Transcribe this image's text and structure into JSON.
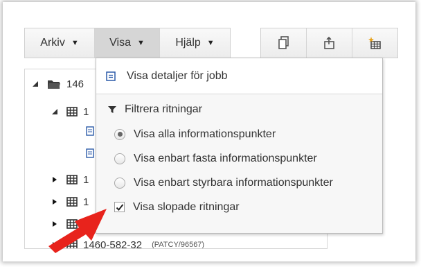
{
  "menubar": {
    "items": [
      {
        "label": "Arkiv",
        "caret": "▼"
      },
      {
        "label": "Visa",
        "caret": "▼"
      },
      {
        "label": "Hjälp",
        "caret": "▼"
      }
    ]
  },
  "toolbar_icons": [
    "copy-icon",
    "export-icon",
    "new-table-icon"
  ],
  "tree": {
    "rows": [
      {
        "text": "146",
        "icon": "folder-icon",
        "expander": "expanded"
      },
      {
        "text": "1",
        "icon": "table-icon",
        "expander": "expanded"
      },
      {
        "text": "",
        "icon": "document-icon",
        "expander": "none"
      },
      {
        "text": "",
        "icon": "document-icon",
        "expander": "none"
      },
      {
        "text": "1",
        "icon": "table-icon",
        "expander": "collapsed"
      },
      {
        "text": "1",
        "icon": "table-icon",
        "expander": "collapsed"
      },
      {
        "text": "",
        "icon": "table-icon",
        "expander": "collapsed"
      },
      {
        "text": "1460-582-32",
        "sub": "(PATCY/96567)",
        "icon": "table-icon",
        "expander": "collapsed"
      }
    ]
  },
  "dropdown": {
    "top_item": "Visa detaljer för jobb",
    "section_label": "Filtrera ritningar",
    "options": [
      {
        "label": "Visa alla informationspunkter",
        "type": "radio",
        "checked": true
      },
      {
        "label": "Visa enbart fasta informationspunkter",
        "type": "radio",
        "checked": false
      },
      {
        "label": "Visa enbart styrbara informationspunkter",
        "type": "radio",
        "checked": false
      },
      {
        "label": "Visa slopade ritningar",
        "type": "checkbox",
        "checked": true
      }
    ]
  },
  "colors": {
    "annotation_arrow": "#e8231c",
    "menu_active_bg": "#d6d6d6",
    "dropdown_bg": "#f7f7f7"
  }
}
